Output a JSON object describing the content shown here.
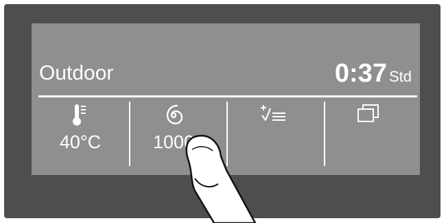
{
  "display": {
    "program": "Outdoor",
    "remaining_time": "0:37",
    "time_unit": "Std"
  },
  "menu": {
    "temperature": {
      "icon": "thermometer-icon",
      "value": "40°C"
    },
    "spin": {
      "icon": "spin-icon",
      "value": "1000"
    },
    "extras": {
      "icon": "extras-icon"
    },
    "multi": {
      "icon": "windows-icon"
    }
  },
  "colors": {
    "frame": "#4e4e4e",
    "screen": "#8f8f8f",
    "text": "#ffffff"
  }
}
